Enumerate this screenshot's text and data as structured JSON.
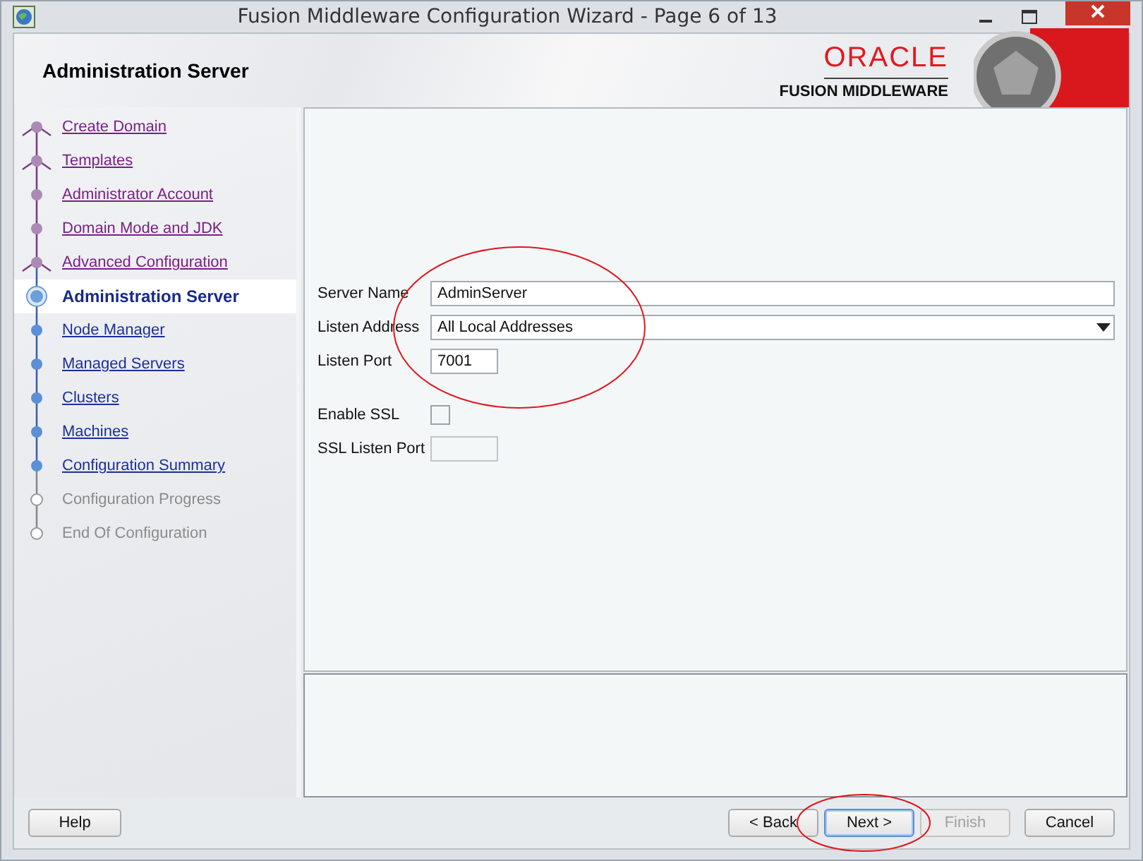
{
  "window": {
    "title": "Fusion Middleware Configuration Wizard - Page 6 of 13"
  },
  "header": {
    "title": "Administration Server",
    "logo_top": "ORACLE",
    "logo_bottom": "FUSION MIDDLEWARE"
  },
  "steps": [
    {
      "label": "Create Domain",
      "kind": "done",
      "branch": true
    },
    {
      "label": "Templates",
      "kind": "done",
      "branch": true
    },
    {
      "label": "Administrator Account",
      "kind": "done",
      "branch": false
    },
    {
      "label": "Domain Mode and JDK",
      "kind": "done",
      "branch": false
    },
    {
      "label": "Advanced Configuration",
      "kind": "done",
      "branch": true
    },
    {
      "label": "Administration Server",
      "kind": "current",
      "branch": false
    },
    {
      "label": "Node Manager",
      "kind": "pending",
      "branch": false
    },
    {
      "label": "Managed Servers",
      "kind": "pending",
      "branch": false
    },
    {
      "label": "Clusters",
      "kind": "pending",
      "branch": false
    },
    {
      "label": "Machines",
      "kind": "pending",
      "branch": false
    },
    {
      "label": "Configuration Summary",
      "kind": "pending",
      "branch": false
    },
    {
      "label": "Configuration Progress",
      "kind": "unavailable",
      "branch": false
    },
    {
      "label": "End Of Configuration",
      "kind": "unavailable",
      "branch": false
    }
  ],
  "form": [
    {
      "kind": "text",
      "label": "Server Name",
      "value": "AdminServer",
      "disabled": false
    },
    {
      "kind": "dropdown",
      "label": "Listen Address",
      "value": "All Local Addresses",
      "disabled": false
    },
    {
      "kind": "number",
      "label": "Listen Port",
      "value": "7001",
      "disabled": false
    },
    {
      "kind": "gap"
    },
    {
      "kind": "checkbox",
      "label": "Enable SSL",
      "checked": false
    },
    {
      "kind": "number",
      "label": "SSL Listen Port",
      "disabled": true
    }
  ],
  "buttons_left": [
    {
      "label": "Help",
      "disabled": false,
      "default": false
    }
  ],
  "buttons_right": [
    {
      "label": "< Back",
      "disabled": false,
      "default": false
    },
    {
      "label": "Next >",
      "disabled": false,
      "default": true
    },
    {
      "label": "Finish",
      "disabled": true,
      "default": false
    },
    {
      "label": "Cancel",
      "disabled": false,
      "default": false
    }
  ]
}
